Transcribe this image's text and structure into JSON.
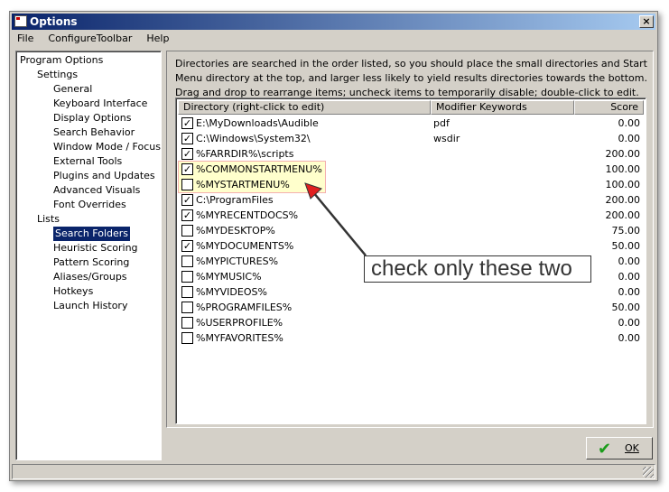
{
  "window": {
    "title": "Options",
    "close": "×"
  },
  "menu": [
    "File",
    "ConfigureToolbar",
    "Help"
  ],
  "tree": [
    {
      "label": "Program Options",
      "level": 0
    },
    {
      "label": "Settings",
      "level": 1
    },
    {
      "label": "General",
      "level": 2
    },
    {
      "label": "Keyboard Interface",
      "level": 2
    },
    {
      "label": "Display Options",
      "level": 2
    },
    {
      "label": "Search Behavior",
      "level": 2
    },
    {
      "label": "Window Mode / Focus",
      "level": 2
    },
    {
      "label": "External Tools",
      "level": 2
    },
    {
      "label": "Plugins and Updates",
      "level": 2
    },
    {
      "label": "Advanced Visuals",
      "level": 2
    },
    {
      "label": "Font Overrides",
      "level": 2
    },
    {
      "label": "Lists",
      "level": 1
    },
    {
      "label": "Search Folders",
      "level": 2,
      "selected": true
    },
    {
      "label": "Heuristic Scoring",
      "level": 2
    },
    {
      "label": "Pattern Scoring",
      "level": 2
    },
    {
      "label": "Aliases/Groups",
      "level": 2
    },
    {
      "label": "Hotkeys",
      "level": 2
    },
    {
      "label": "Launch History",
      "level": 2
    }
  ],
  "description": "Directories are searched in the order listed, so you should place the small directories and Start Menu directory at the top, and larger less likely to yield results directories towards the bottom.  Drag and drop to rearrange items; uncheck items to temporarily disable; double-click to edit.",
  "columns": [
    "Directory (right-click to edit)",
    "Modifier Keywords",
    "Score"
  ],
  "rows": [
    {
      "dir": "E:\\MyDownloads\\Audible",
      "kw": "pdf",
      "score": "0.00",
      "checked": true
    },
    {
      "dir": "C:\\Windows\\System32\\",
      "kw": "wsdir",
      "score": "0.00",
      "checked": true
    },
    {
      "dir": "%FARRDIR%\\scripts",
      "kw": "",
      "score": "200.00",
      "checked": true
    },
    {
      "dir": "%COMMONSTARTMENU%",
      "kw": "",
      "score": "100.00",
      "checked": true
    },
    {
      "dir": "%MYSTARTMENU%",
      "kw": "",
      "score": "100.00",
      "checked": false
    },
    {
      "dir": "C:\\ProgramFiles",
      "kw": "",
      "score": "200.00",
      "checked": true
    },
    {
      "dir": "%MYRECENTDOCS%",
      "kw": "",
      "score": "200.00",
      "checked": true
    },
    {
      "dir": "%MYDESKTOP%",
      "kw": "",
      "score": "75.00",
      "checked": false
    },
    {
      "dir": "%MYDOCUMENTS%",
      "kw": "",
      "score": "50.00",
      "checked": true
    },
    {
      "dir": "%MYPICTURES%",
      "kw": "",
      "score": "0.00",
      "checked": false
    },
    {
      "dir": "%MYMUSIC%",
      "kw": "",
      "score": "0.00",
      "checked": false
    },
    {
      "dir": "%MYVIDEOS%",
      "kw": "",
      "score": "0.00",
      "checked": false
    },
    {
      "dir": "%PROGRAMFILES%",
      "kw": "",
      "score": "50.00",
      "checked": false
    },
    {
      "dir": "%USERPROFILE%",
      "kw": "",
      "score": "0.00",
      "checked": false
    },
    {
      "dir": "%MYFAVORITES%",
      "kw": "",
      "score": "0.00",
      "checked": false
    }
  ],
  "annotation": "check only these two",
  "ok_label": "OK",
  "colors": {
    "titlebar": "#0a246a",
    "highlight": "#ffffcc",
    "arrow": "#e02020"
  }
}
